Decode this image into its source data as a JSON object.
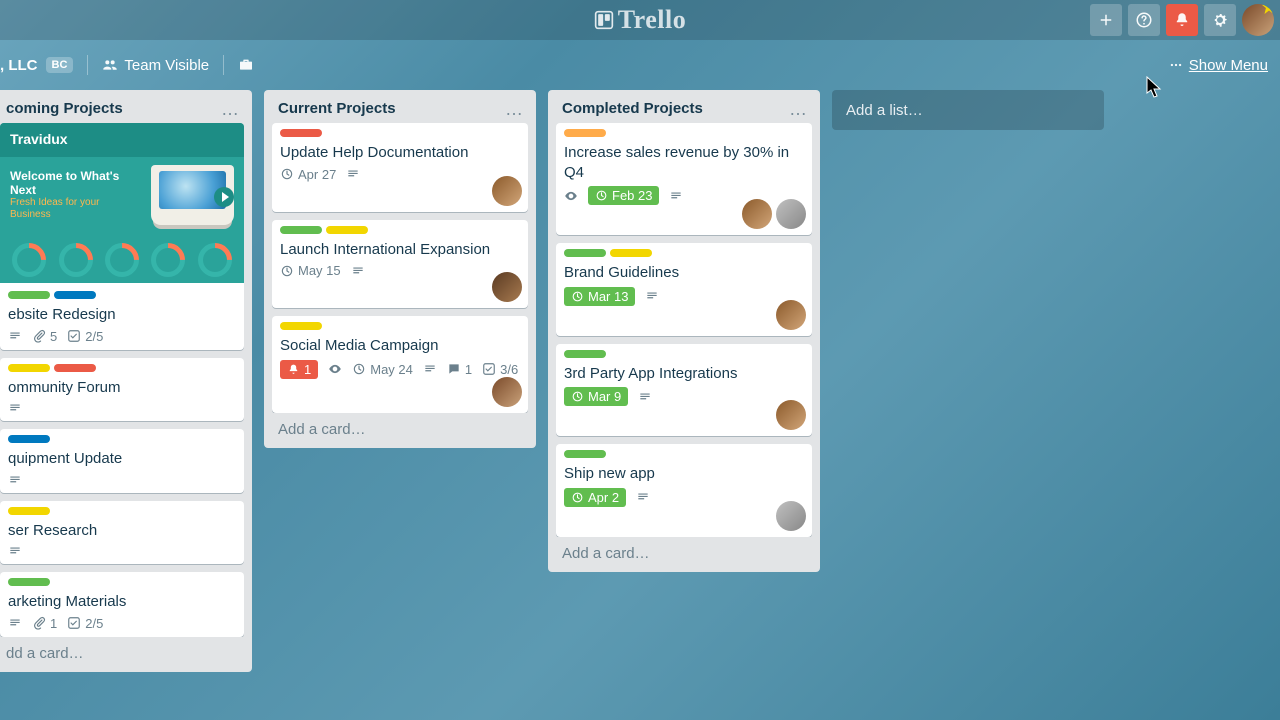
{
  "app": {
    "name": "Trello"
  },
  "topbar": {
    "add_tooltip": "Create",
    "help_tooltip": "Help",
    "alert_tooltip": "Notifications",
    "settings_tooltip": "Settings"
  },
  "boardbar": {
    "org_name": ", LLC",
    "org_badge": "BC",
    "visibility": "Team Visible",
    "show_menu": "Show Menu"
  },
  "add_list_placeholder": "Add a list…",
  "lists": [
    {
      "title": "coming Projects",
      "add_card": "dd a card…",
      "cards": [
        {
          "cover": true,
          "cover_brand": "Travidux",
          "cover_headline": "Welcome to What's Next",
          "cover_sub": "Fresh Ideas for your Business",
          "labels": [
            "green",
            "blue"
          ],
          "title": "ebsite Redesign",
          "badges": {
            "attach": "5",
            "check": "2/5",
            "desc": true
          }
        },
        {
          "labels": [
            "yellow",
            "red"
          ],
          "title": "ommunity Forum",
          "badges": {
            "desc": true
          }
        },
        {
          "labels": [
            "blue"
          ],
          "title": "quipment Update",
          "badges": {
            "desc": true
          }
        },
        {
          "labels": [
            "yellow"
          ],
          "title": "ser Research",
          "badges": {
            "desc": true
          }
        },
        {
          "labels": [
            "green"
          ],
          "title": "arketing Materials",
          "badges": {
            "attach": "1",
            "check": "2/5",
            "desc": true
          }
        }
      ]
    },
    {
      "title": "Current Projects",
      "add_card": "Add a card…",
      "cards": [
        {
          "labels": [
            "red"
          ],
          "title": "Update Help Documentation",
          "badges": {
            "date": "Apr 27",
            "desc": true
          },
          "members": [
            "m1"
          ]
        },
        {
          "labels": [
            "green",
            "yellow"
          ],
          "title": "Launch International Expansion",
          "badges": {
            "date": "May 15",
            "desc": true
          },
          "members": [
            "m2"
          ]
        },
        {
          "labels": [
            "yellow"
          ],
          "title": "Social Media Campaign",
          "badges": {
            "notif": "1",
            "watch": true,
            "date": "May 24",
            "desc": true,
            "comments": "1",
            "check": "3/6"
          },
          "members": [
            "m4"
          ]
        }
      ]
    },
    {
      "title": "Completed Projects",
      "add_card": "Add a card…",
      "cards": [
        {
          "labels": [
            "orange"
          ],
          "title": "Increase sales revenue by 30% in Q4",
          "badges": {
            "watch": true,
            "due": "Feb 23",
            "desc": true
          },
          "members": [
            "m1",
            "m3"
          ]
        },
        {
          "labels": [
            "green",
            "yellow"
          ],
          "title": "Brand Guidelines",
          "badges": {
            "due": "Mar 13",
            "desc": true
          },
          "members": [
            "m1"
          ]
        },
        {
          "labels": [
            "green"
          ],
          "title": "3rd Party App Integrations",
          "badges": {
            "due": "Mar 9",
            "desc": true
          },
          "members": [
            "m1"
          ]
        },
        {
          "labels": [
            "green"
          ],
          "title": "Ship new app",
          "badges": {
            "due": "Apr 2",
            "desc": true
          },
          "members": [
            "m3"
          ]
        }
      ]
    }
  ]
}
